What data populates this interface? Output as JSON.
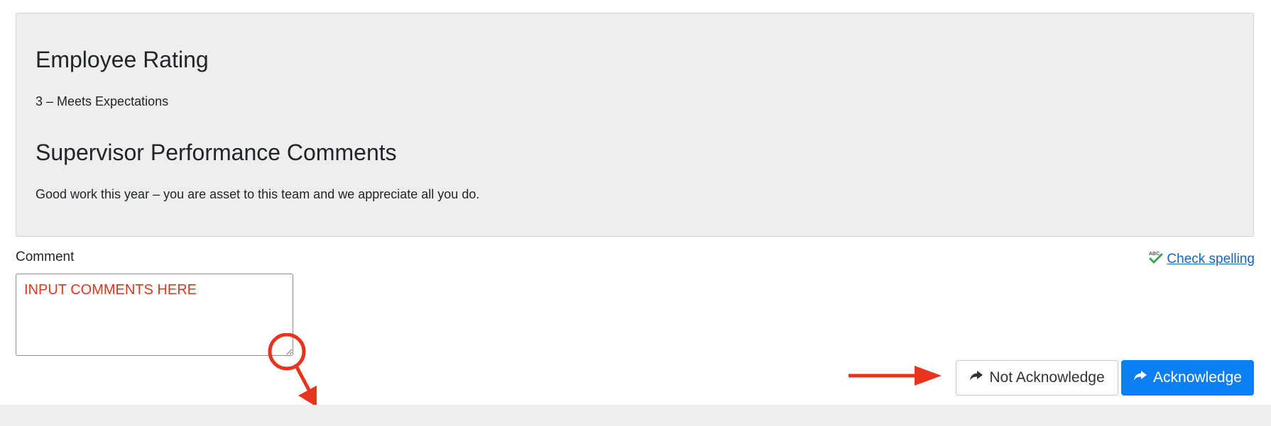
{
  "review": {
    "rating_heading": "Employee Rating",
    "rating_value": "3 – Meets Expectations",
    "comments_heading": "Supervisor Performance Comments",
    "comments_text": "Good work this year – you are asset to this team and we appreciate all you do."
  },
  "comment_form": {
    "label": "Comment",
    "placeholder": "INPUT COMMENTS HERE",
    "spell_check_label": "Check spelling",
    "spell_check_icon": "abc-checkmark-icon"
  },
  "actions": {
    "not_acknowledge_label": "Not Acknowledge",
    "acknowledge_label": "Acknowledge",
    "button_icon": "share-forward-icon"
  },
  "colors": {
    "panel_background": "#eeeeee",
    "primary_button": "#0d7ff5",
    "annotation": "#e8341c",
    "link": "#1565c0"
  }
}
